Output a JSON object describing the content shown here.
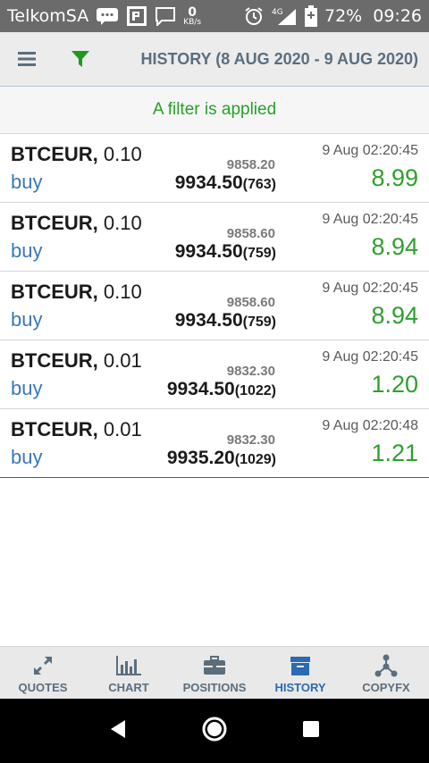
{
  "status_bar": {
    "carrier": "TelkomSA",
    "speed_value": "0",
    "speed_unit": "KB/s",
    "network": "4G",
    "battery": "72%",
    "time": "09:26"
  },
  "header": {
    "menu_icon": "hamburger-icon",
    "filter_icon": "filter-icon",
    "title": "HISTORY (8 AUG 2020 - 9 AUG 2020)"
  },
  "filter_notice": "A filter is applied",
  "trades": [
    {
      "symbol": "BTCEUR,",
      "volume": "0.10",
      "side": "buy",
      "open_price": "9858.20",
      "close_price": "9934.50",
      "points": "(763)",
      "time": "9 Aug 02:20:45",
      "profit": "8.99"
    },
    {
      "symbol": "BTCEUR,",
      "volume": "0.10",
      "side": "buy",
      "open_price": "9858.60",
      "close_price": "9934.50",
      "points": "(759)",
      "time": "9 Aug 02:20:45",
      "profit": "8.94"
    },
    {
      "symbol": "BTCEUR,",
      "volume": "0.10",
      "side": "buy",
      "open_price": "9858.60",
      "close_price": "9934.50",
      "points": "(759)",
      "time": "9 Aug 02:20:45",
      "profit": "8.94"
    },
    {
      "symbol": "BTCEUR,",
      "volume": "0.01",
      "side": "buy",
      "open_price": "9832.30",
      "close_price": "9934.50",
      "points": "(1022)",
      "time": "9 Aug 02:20:45",
      "profit": "1.20"
    },
    {
      "symbol": "BTCEUR,",
      "volume": "0.01",
      "side": "buy",
      "open_price": "9832.30",
      "close_price": "9935.20",
      "points": "(1029)",
      "time": "9 Aug 02:20:48",
      "profit": "1.21"
    }
  ],
  "bottom_nav": [
    {
      "label": "QUOTES",
      "icon": "quotes-icon"
    },
    {
      "label": "CHART",
      "icon": "chart-icon"
    },
    {
      "label": "POSITIONS",
      "icon": "briefcase-icon"
    },
    {
      "label": "HISTORY",
      "icon": "archive-icon",
      "active": true
    },
    {
      "label": "COPYFX",
      "icon": "network-icon"
    }
  ],
  "colors": {
    "accent_blue": "#2a6ab0",
    "profit_green": "#2ea02e",
    "header_text": "#5a6e7e"
  }
}
